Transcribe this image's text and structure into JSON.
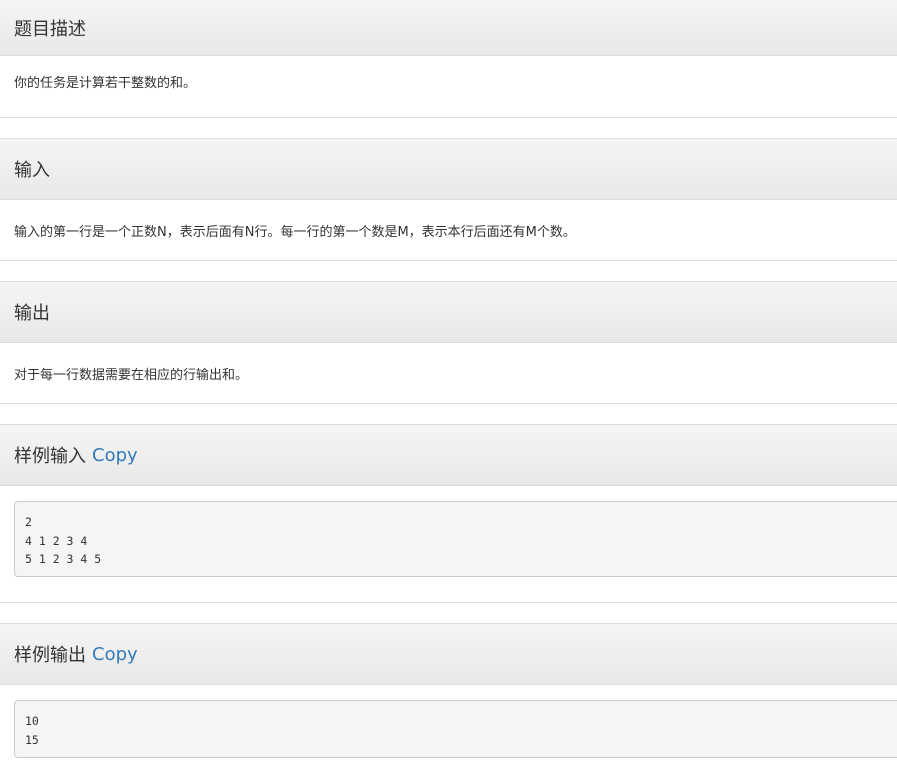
{
  "sections": {
    "description": {
      "title": "题目描述",
      "body": "你的任务是计算若干整数的和。"
    },
    "input": {
      "title": "输入",
      "body": "输入的第一行是一个正数N，表示后面有N行。每一行的第一个数是M，表示本行后面还有M个数。"
    },
    "output": {
      "title": "输出",
      "body": "对于每一行数据需要在相应的行输出和。"
    },
    "sample_input": {
      "title": "样例输入",
      "copy_label": "Copy",
      "content": "2\n4 1 2 3 4\n5 1 2 3 4 5"
    },
    "sample_output": {
      "title": "样例输出",
      "copy_label": "Copy",
      "content": "10\n15"
    }
  },
  "colors": {
    "link": "#337ab7",
    "heading_bg": "#eeeeee",
    "border": "#dddddd"
  }
}
